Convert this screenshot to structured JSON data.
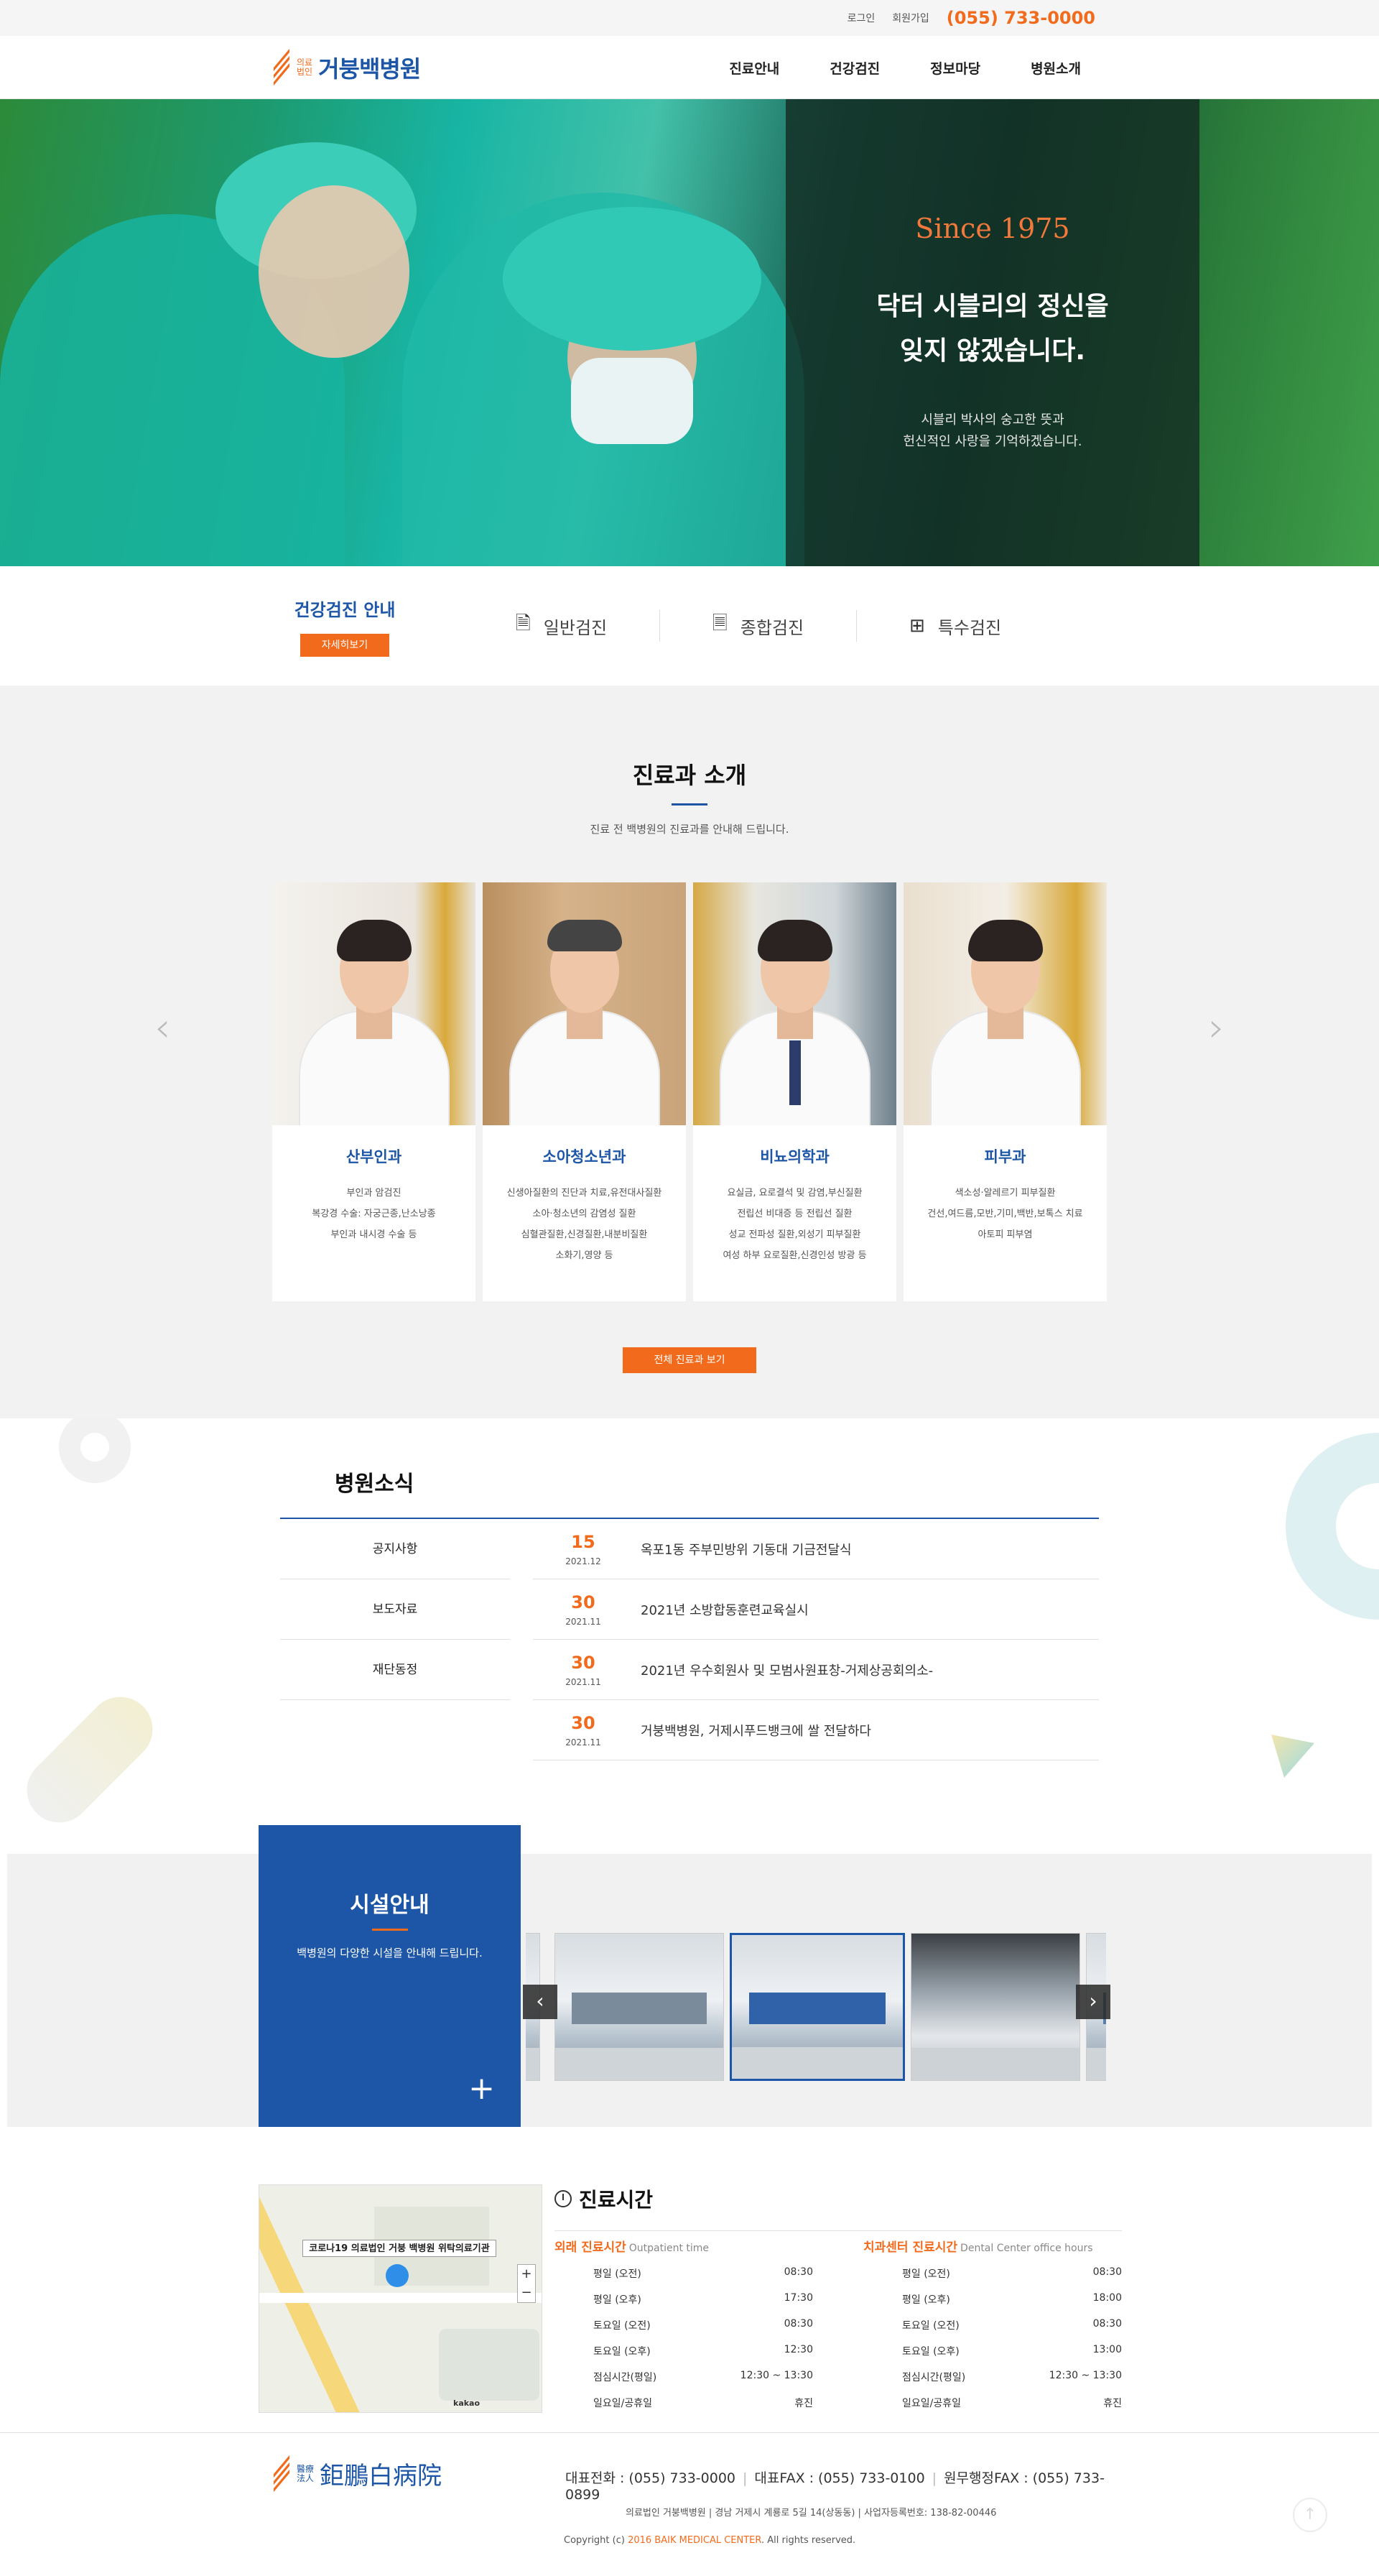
{
  "topbar": {
    "login": "로그인",
    "join": "회원가입",
    "phone": "(055) 733-0000"
  },
  "header": {
    "logo_small_1": "의료",
    "logo_small_2": "법인",
    "logo_text": "거붕백병원",
    "nav": [
      "진료안내",
      "건강검진",
      "정보마당",
      "병원소개"
    ]
  },
  "hero": {
    "since": "Since 1975",
    "headline_1": "닥터 시블리의 정신을",
    "headline_2": "잊지 않겠습니다.",
    "sub_1": "시블리 박사의 숭고한 뜻과",
    "sub_2": "헌신적인 사랑을 기억하겠습니다."
  },
  "checkup": {
    "title": "건강검진 안내",
    "more": "자세히보기",
    "items": [
      {
        "label": "일반검진",
        "icon": "document-lines-icon"
      },
      {
        "label": "종합검진",
        "icon": "document-filled-icon"
      },
      {
        "label": "특수검진",
        "icon": "document-plus-icon"
      }
    ]
  },
  "depts": {
    "title": "진료과 소개",
    "desc": "진료 전 백병원의 진료과를 안내해 드립니다.",
    "all_button": "전체 진료과 보기",
    "cards": [
      {
        "name": "산부인과",
        "lines": [
          "부인과 암검진",
          "복강경 수술: 자궁근종,난소낭종",
          "부인과 내시경 수술 등"
        ]
      },
      {
        "name": "소아청소년과",
        "lines": [
          "신생아질환의 진단과 치료,유전대사질환",
          "소아·청소년의 감염성 질환",
          "심혈관질환,신경질환,내분비질환",
          "소화기,영양 등"
        ]
      },
      {
        "name": "비뇨의학과",
        "lines": [
          "요실금, 요로결석 및 감염,부신질환",
          "전립선 비대증 등 전립선 질환",
          "성교 전파성 질환,외성기 피부질환",
          "여성 하부 요로질환,신경인성 방광 등"
        ]
      },
      {
        "name": "피부과",
        "lines": [
          "색소성·알레르기 피부질환",
          "건선,여드름,모반,기미,백반,보톡스 치료",
          "아토피 피부염"
        ]
      }
    ]
  },
  "news": {
    "title": "병원소식",
    "tabs": [
      "공지사항",
      "보도자료",
      "재단동정"
    ],
    "items": [
      {
        "day": "15",
        "ym": "2021.12",
        "title": "옥포1동 주부민방위 기동대 기금전달식"
      },
      {
        "day": "30",
        "ym": "2021.11",
        "title": "2021년 소방합동훈련교육실시"
      },
      {
        "day": "30",
        "ym": "2021.11",
        "title": "2021년 우수회원사 및 모범사원표창-거제상공회의소-"
      },
      {
        "day": "30",
        "ym": "2021.11",
        "title": "거붕백병원, 거제시푸드뱅크에 쌀 전달하다"
      }
    ]
  },
  "facility": {
    "title": "시설안내",
    "desc": "백병원의 다양한 시설을 안내해 드립니다.",
    "plus": "+",
    "prev": "‹",
    "next": "›"
  },
  "map": {
    "label": "코로나19 의료법인 거붕 백병원 위탁의료기관",
    "brand": "kakao"
  },
  "hours": {
    "title": "진료시간",
    "outpatient": {
      "title": "외래 진료시간",
      "en": "Outpatient time",
      "rows": [
        {
          "k": "평일 (오전)",
          "v": "08:30"
        },
        {
          "k": "평일 (오후)",
          "v": "17:30"
        },
        {
          "k": "토요일 (오전)",
          "v": "08:30"
        },
        {
          "k": "토요일 (오후)",
          "v": "12:30"
        },
        {
          "k": "점심시간(평일)",
          "v": "12:30 ~ 13:30"
        },
        {
          "k": "일요일/공휴일",
          "v": "휴진"
        }
      ]
    },
    "dental": {
      "title": "치과센터 진료시간",
      "en": "Dental Center office hours",
      "rows": [
        {
          "k": "평일 (오전)",
          "v": "08:30"
        },
        {
          "k": "평일 (오후)",
          "v": "18:00"
        },
        {
          "k": "토요일 (오전)",
          "v": "08:30"
        },
        {
          "k": "토요일 (오후)",
          "v": "13:00"
        },
        {
          "k": "점심시간(평일)",
          "v": "12:30 ~ 13:30"
        },
        {
          "k": "일요일/공휴일",
          "v": "휴진"
        }
      ]
    }
  },
  "footer": {
    "logo_small_1": "醫療",
    "logo_small_2": "法人",
    "logo_big": "鉅鵬白病院",
    "tel": "대표전화 : (055) 733-0000",
    "fax": "대표FAX : (055) 733-0100",
    "admin_fax": "원무행정FAX : (055) 733-0899",
    "addr": "의료법인 거붕백병원  |  경남 거제시 계룡로 5길 14(상동동)  |  사업자등록번호: 138-82-00446",
    "copy_pre": "Copyright (c) ",
    "copy_hl": "2016 BAIK MEDICAL CENTER",
    "copy_post": ". All rights reserved.",
    "totop": "↑"
  },
  "colors": {
    "accent": "#f26b1d",
    "brand": "#1d56a6"
  }
}
